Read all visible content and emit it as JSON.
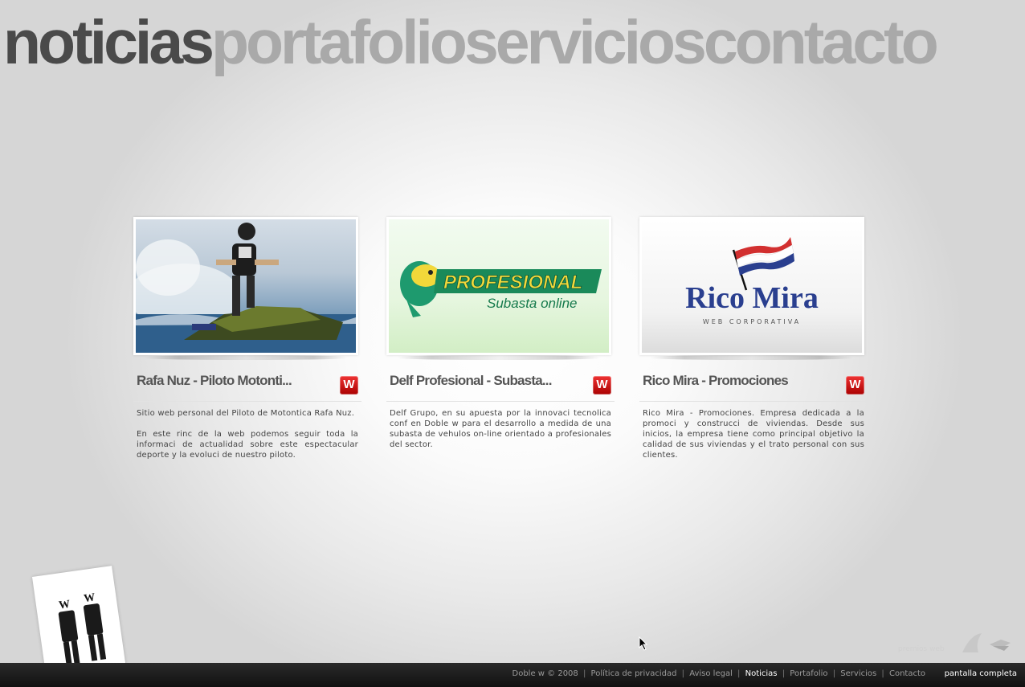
{
  "top_nav": {
    "items": [
      {
        "label": "noticias",
        "active": true
      },
      {
        "label": "portafolio",
        "active": false
      },
      {
        "label": "servicios",
        "active": false
      },
      {
        "label": "contacto",
        "active": false
      }
    ]
  },
  "cards": [
    {
      "title": "Rafa Nuz - Piloto Motonti...",
      "badge": "W",
      "desc": [
        "Sitio web personal del Piloto de Motontica Rafa Nuz.",
        "En este rinc de la web podemos seguir toda la informaci de actualidad sobre este espectacular deporte y la evoluci de nuestro piloto."
      ],
      "image": "jet-ski-photo"
    },
    {
      "title": "Delf Profesional - Subasta...",
      "badge": "W",
      "desc": [
        "Delf Grupo, en su apuesta por la innovaci tecnolica conf en Doble w para el desarrollo a medida de una subasta de vehulos on-line orientado a profesionales del sector."
      ],
      "image_text": {
        "brand": "PROFESIONAL",
        "sub": "Subasta online"
      }
    },
    {
      "title": "Rico Mira - Promociones",
      "badge": "W",
      "desc": [
        "Rico Mira - Promociones. Empresa dedicada a la promoci y construcci de viviendas. Desde sus inicios, la empresa tiene como principal objetivo la calidad de sus viviendas y el trato personal con sus clientes."
      ],
      "image_text": {
        "brand": "Rico Mira",
        "sub": "WEB CORPORATIVA"
      }
    }
  ],
  "footer": {
    "copyright": "Doble w © 2008",
    "links": [
      {
        "label": "Política de privacidad",
        "active": false
      },
      {
        "label": "Aviso legal",
        "active": false
      },
      {
        "label": "Noticias",
        "active": true
      },
      {
        "label": "Portafolio",
        "active": false
      },
      {
        "label": "Servicios",
        "active": false
      },
      {
        "label": "Contacto",
        "active": false
      }
    ],
    "separator": "|",
    "fullscreen": "pantalla completa",
    "premios": "premios web"
  },
  "colors": {
    "nav_active": "#4a4a4a",
    "nav_inactive": "#a9a9a9",
    "badge_red": "#cc1111",
    "footer_bg": "#1a1a1a"
  }
}
